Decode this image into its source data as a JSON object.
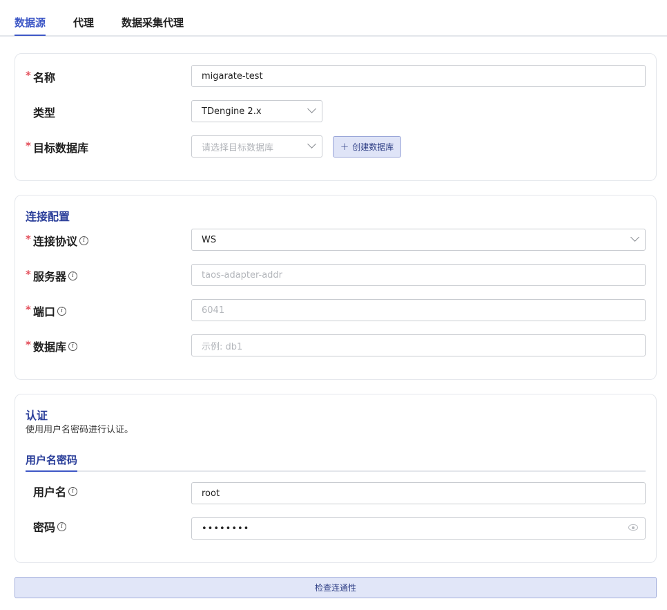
{
  "tabs": [
    {
      "label": "数据源"
    },
    {
      "label": "代理"
    },
    {
      "label": "数据采集代理"
    }
  ],
  "basic": {
    "name_label": "名称",
    "name_value": "migarate-test",
    "type_label": "类型",
    "type_value": "TDengine 2.x",
    "target_db_label": "目标数据库",
    "target_db_placeholder": "请选择目标数据库",
    "create_db_button": "创建数据库"
  },
  "connection": {
    "title": "连接配置",
    "protocol_label": "连接协议",
    "protocol_value": "WS",
    "server_label": "服务器",
    "server_placeholder": "taos-adapter-addr",
    "port_label": "端口",
    "port_placeholder": "6041",
    "database_label": "数据库",
    "database_placeholder": "示例: db1"
  },
  "auth": {
    "title": "认证",
    "description": "使用用户名密码进行认证。",
    "tab_label": "用户名密码",
    "username_label": "用户名",
    "username_value": "root",
    "password_label": "密码",
    "password_value": "••••••••"
  },
  "actions": {
    "check_button": "检查连通性"
  },
  "icons": {
    "plus": "plus-icon",
    "info": "info-icon",
    "chevron": "chevron-down-icon",
    "eye": "eye-icon"
  },
  "colors": {
    "accent": "#3d57c6",
    "required": "#e34d59",
    "button_bg": "#e1e6f8"
  }
}
